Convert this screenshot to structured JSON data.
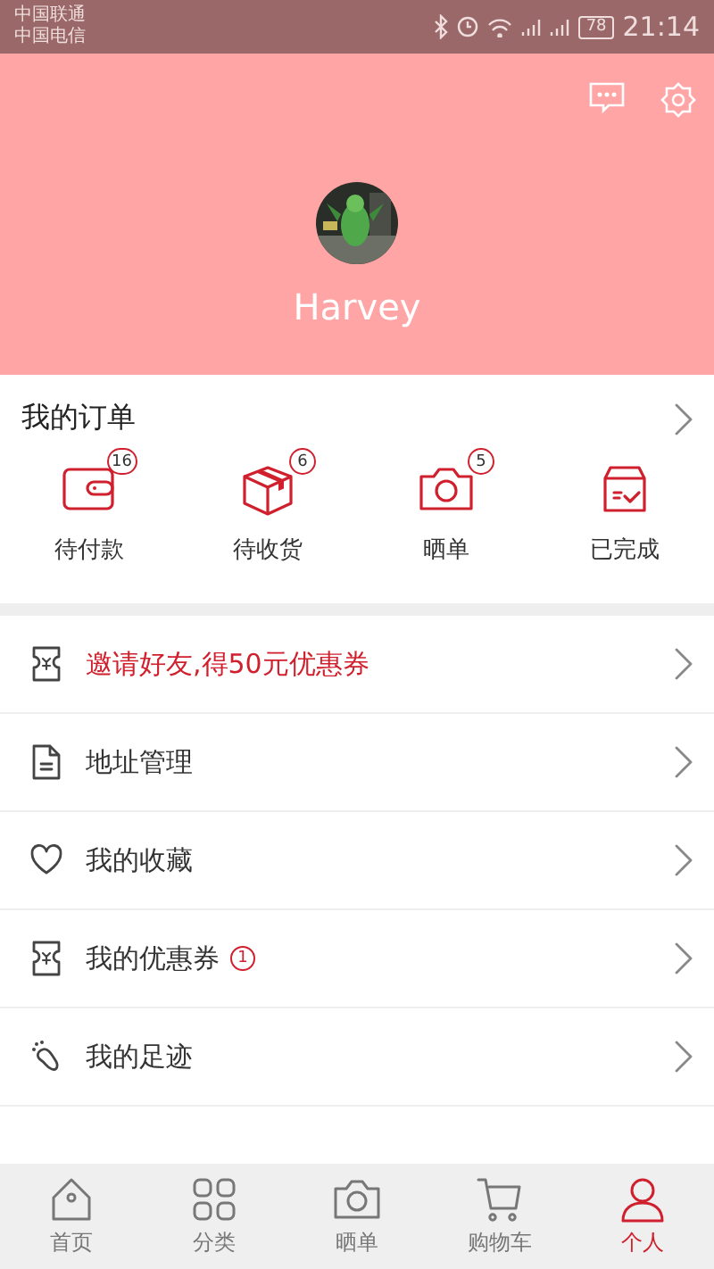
{
  "status_bar": {
    "carriers": [
      "中国联通",
      "中国电信"
    ],
    "battery": "78",
    "time": "21:14"
  },
  "profile": {
    "name": "Harvey"
  },
  "orders": {
    "title": "我的订单",
    "items": [
      {
        "kind": "wallet",
        "label": "待付款",
        "badge": "16"
      },
      {
        "kind": "box",
        "label": "待收货",
        "badge": "6"
      },
      {
        "kind": "camera",
        "label": "晒单",
        "badge": "5"
      },
      {
        "kind": "done",
        "label": "已完成"
      }
    ]
  },
  "menu": [
    {
      "kind": "coupon",
      "label": "邀请好友,得50元优惠券",
      "highlight": true
    },
    {
      "kind": "address",
      "label": "地址管理",
      "highlight": false
    },
    {
      "kind": "heart",
      "label": "我的收藏",
      "highlight": false
    },
    {
      "kind": "coupon",
      "label": "我的优惠券",
      "highlight": false,
      "badge": "1"
    },
    {
      "kind": "foot",
      "label": "我的足迹",
      "highlight": false
    }
  ],
  "tabs": [
    {
      "kind": "home",
      "label": "首页",
      "selected": false
    },
    {
      "kind": "grid",
      "label": "分类",
      "selected": false
    },
    {
      "kind": "camera",
      "label": "晒单",
      "selected": false
    },
    {
      "kind": "cart",
      "label": "购物车",
      "selected": false
    },
    {
      "kind": "person",
      "label": "个人",
      "selected": true
    }
  ]
}
